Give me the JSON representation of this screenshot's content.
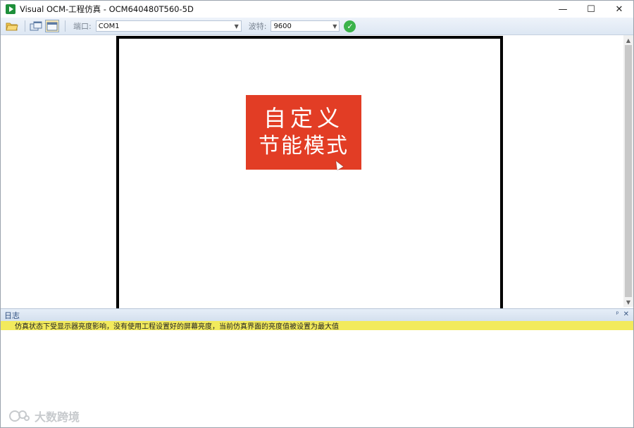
{
  "window": {
    "title": "Visual OCM-工程仿真 - OCM640480T560-5D",
    "min_glyph": "—",
    "max_glyph": "☐",
    "close_glyph": "✕"
  },
  "toolbar": {
    "port_label": "端口:",
    "port_value": "COM1",
    "baud_label": "波特:",
    "baud_value": "9600",
    "connect_icon": "checkmark-icon"
  },
  "screen": {
    "button_line1": "自定义",
    "button_line2": "节能模式",
    "button_color": "#e23d25"
  },
  "log": {
    "title": "日志",
    "pin_glyph": "ᵖ",
    "close_glyph": "✕",
    "message": "仿真状态下受显示器亮度影响，没有使用工程设置好的屏幕亮度，当前仿真界面的亮度值被设置为最大值",
    "message_bg": "#f2ea5c"
  },
  "watermark": {
    "text": "大数跨境"
  }
}
